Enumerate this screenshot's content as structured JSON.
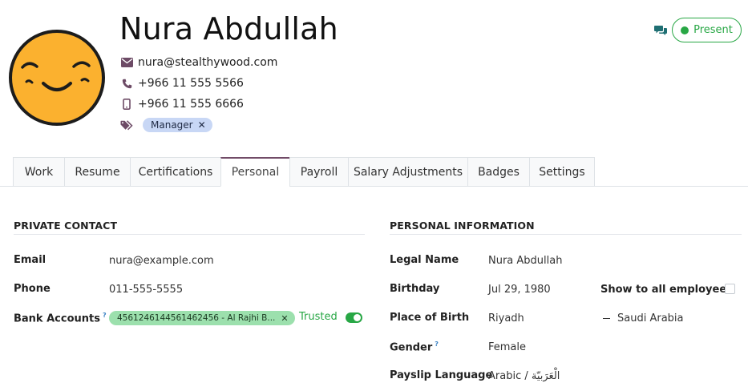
{
  "employee": {
    "name": "Nura Abdullah",
    "email": "nura@stealthywood.com",
    "phone": "+966 11 555 5566",
    "mobile": "+966 11 555 6666",
    "tags": [
      "Manager"
    ]
  },
  "status": {
    "label": "Present",
    "color": "#28a745"
  },
  "tabs": [
    "Work",
    "Resume",
    "Certifications",
    "Personal",
    "Payroll",
    "Salary Adjustments",
    "Badges",
    "Settings"
  ],
  "active_tab": "Personal",
  "private_contact": {
    "title": "PRIVATE CONTACT",
    "email_label": "Email",
    "email": "nura@example.com",
    "phone_label": "Phone",
    "phone": "011-555-5555",
    "bank_label": "Bank Accounts",
    "bank_help": "?",
    "bank_account": "4561246144561462456 - Al Rajhi B...",
    "trusted_label": "Trusted",
    "trusted": true
  },
  "personal_information": {
    "title": "PERSONAL INFORMATION",
    "legal_name_label": "Legal Name",
    "legal_name": "Nura Abdullah",
    "birthday_label": "Birthday",
    "birthday": "Jul 29, 1980",
    "show_label": "Show to all employees",
    "place_label": "Place of Birth",
    "place": "Riyadh",
    "country": "Saudi Arabia",
    "gender_label": "Gender",
    "gender_help": "?",
    "gender": "Female",
    "payslip_label": "Payslip Language",
    "payslip": "Arabic / الْعَرَبيّة"
  },
  "colors": {
    "brand": "#714b67",
    "accent_green": "#28a745",
    "tag_bg": "#c8d7f5",
    "bank_tag_bg": "#9ce0ad"
  }
}
